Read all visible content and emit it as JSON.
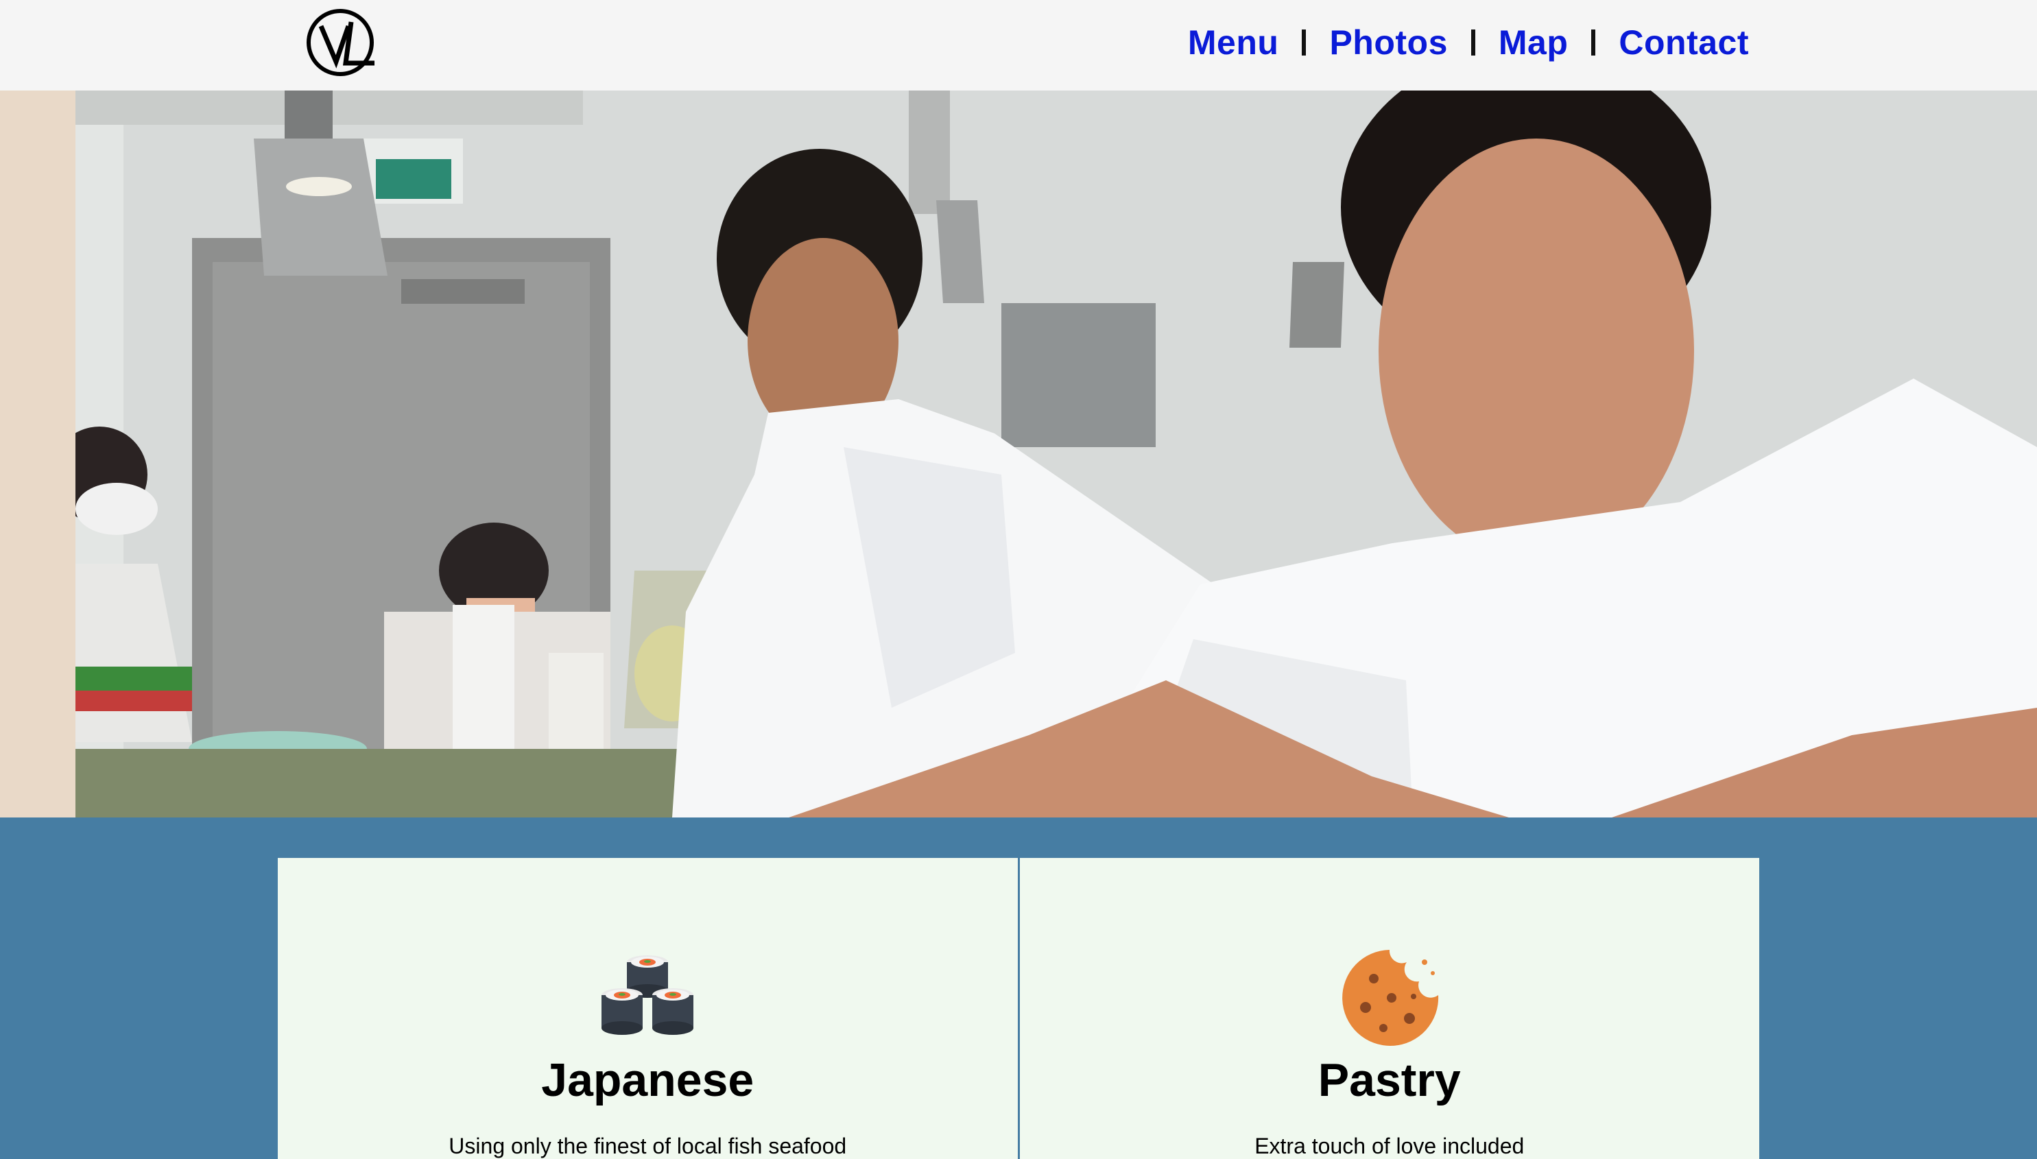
{
  "header": {
    "logo_icon": "vl-logo-icon",
    "nav": [
      {
        "label": "Menu"
      },
      {
        "label": "Photos"
      },
      {
        "label": "Map"
      },
      {
        "label": "Contact"
      }
    ],
    "link_color": "#0a1bd8"
  },
  "hero": {
    "image": "chefs-preparing-food-photo"
  },
  "cards": [
    {
      "icon": "sushi-icon",
      "title": "Japanese",
      "description": "Using only the finest of local fish seafood"
    },
    {
      "icon": "cookie-icon",
      "title": "Pastry",
      "description": "Extra touch of love included"
    }
  ],
  "colors": {
    "section_bg": "#467da3",
    "card_bg": "#f0f9ef",
    "header_bg": "#f5f5f5"
  }
}
